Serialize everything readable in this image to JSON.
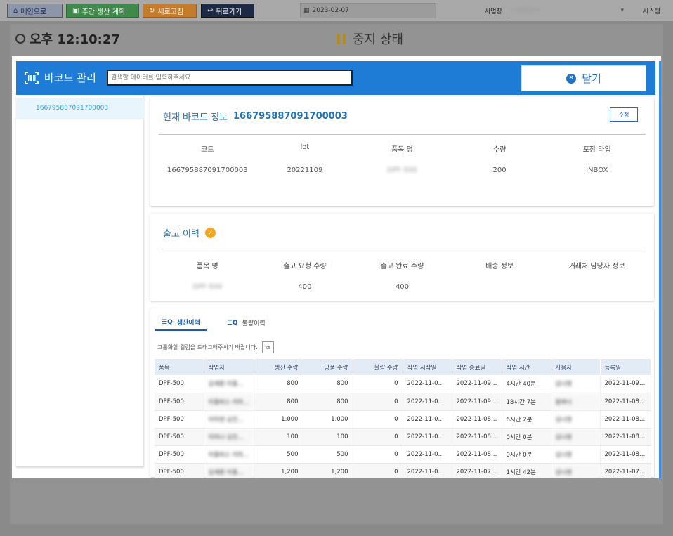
{
  "topbar": {
    "main_btn": "메인으로",
    "plan_btn": "주간 생산 계획",
    "refresh_btn": "새로고침",
    "back_btn": "뒤로가기",
    "date": "2023-02-07",
    "biz_label": "사업장",
    "biz_value": "**바이오**",
    "system_btn": "시스템"
  },
  "status": {
    "time": "오후 12:10:27",
    "state": "중지 상태"
  },
  "modal": {
    "title": "바코드 관리",
    "search_placeholder": "검색할 데이터를 입력하주세요",
    "close_label": "닫기",
    "list_items": [
      "166795887091700003"
    ]
  },
  "barcode_info": {
    "title": "현재 바코드 정보",
    "code": "166795887091700003",
    "edit_label": "수정",
    "headers": [
      "코드",
      "lot",
      "품목 명",
      "수량",
      "포장 타입"
    ],
    "values": [
      "166795887091700003",
      "20221109",
      "DPF-500",
      "200",
      "INBOX"
    ]
  },
  "shipment": {
    "title": "출고 이력",
    "headers": [
      "품목 명",
      "출고 요청 수량",
      "출고 완료 수량",
      "배송 정보",
      "거래처 담당자 정보"
    ],
    "values": [
      "DPF-500",
      "400",
      "400",
      "",
      ""
    ]
  },
  "history": {
    "tabs": [
      "생산이력",
      "불량이력"
    ],
    "group_hint": "그룹화할 컬럼을 드래그해주시기 바랍니다.",
    "columns": [
      "품목",
      "작업자",
      "생산 수량",
      "양품 수량",
      "불량 수량",
      "작업 시작일",
      "작업 종료일",
      "작업 시간",
      "사용자",
      "등록일"
    ],
    "rows": [
      [
        "DPF-500",
        "김세환 이플...",
        "800",
        "800",
        "0",
        "2022-11-09 ...",
        "2022-11-09 ...",
        "4시간 40분",
        "김나영",
        "2022-11-09 ..."
      ],
      [
        "DPF-500",
        "이플비스 이미...",
        "800",
        "800",
        "0",
        "2022-11-08 ...",
        "2022-11-09 ...",
        "18시간 7분",
        "홍바나",
        "2022-11-08 ..."
      ],
      [
        "DPF-500",
        "이미연 김진...",
        "1,000",
        "1,000",
        "0",
        "2022-11-08 ...",
        "2022-11-08 ...",
        "6시간 2분",
        "김나영",
        "2022-11-08 ..."
      ],
      [
        "DPF-500",
        "이미나 김진...",
        "100",
        "100",
        "0",
        "2022-11-08 ...",
        "2022-11-08 ...",
        "0시간 0분",
        "김나영",
        "2022-11-08 ..."
      ],
      [
        "DPF-500",
        "이플비스 이미...",
        "500",
        "500",
        "0",
        "2022-11-08 ...",
        "2022-11-08 ...",
        "0시간 0분",
        "김나영",
        "2022-11-08 ..."
      ],
      [
        "DPF-500",
        "김세환 이플...",
        "1,200",
        "1,200",
        "0",
        "2022-11-07 ...",
        "2022-11-07 ...",
        "1시간 42분",
        "김나영",
        "2022-11-07 ..."
      ]
    ]
  }
}
